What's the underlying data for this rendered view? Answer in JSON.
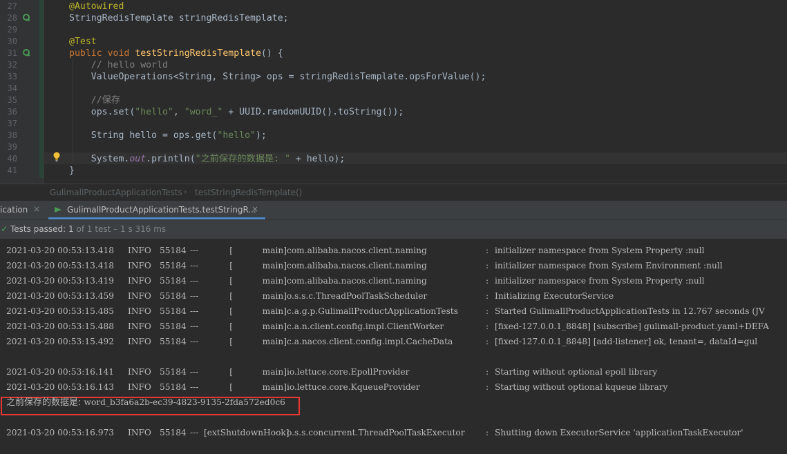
{
  "editor": {
    "lines": [
      {
        "num": "27",
        "tokens": [
          {
            "t": "@Autowired",
            "c": "ann"
          }
        ]
      },
      {
        "num": "28",
        "icon": "bean-gutter-icon",
        "tokens": [
          {
            "t": "StringRedisTemplate stringRedisTemplate;",
            "c": ""
          }
        ]
      },
      {
        "num": "29",
        "tokens": []
      },
      {
        "num": "30",
        "tokens": [
          {
            "t": "@Test",
            "c": "ann"
          }
        ]
      },
      {
        "num": "31",
        "icon": "run-test-gutter-icon",
        "tokens": [
          {
            "t": "public void ",
            "c": "kw"
          },
          {
            "t": "testStringRedisTemplate",
            "c": "mth"
          },
          {
            "t": "() {",
            "c": ""
          }
        ]
      },
      {
        "num": "32",
        "tokens": [
          {
            "t": "    // hello world",
            "c": "cm"
          }
        ]
      },
      {
        "num": "33",
        "tokens": [
          {
            "t": "    ValueOperations<String, String> ops = stringRedisTemplate.opsForValue();",
            "c": ""
          }
        ]
      },
      {
        "num": "34",
        "tokens": []
      },
      {
        "num": "35",
        "tokens": [
          {
            "t": "    //保存",
            "c": "cm"
          }
        ]
      },
      {
        "num": "36",
        "tokens": [
          {
            "t": "    ops.set(",
            "c": ""
          },
          {
            "t": "\"hello\"",
            "c": "str"
          },
          {
            "t": ", ",
            "c": ""
          },
          {
            "t": "\"word_\"",
            "c": "str"
          },
          {
            "t": " + UUID.randomUUID().toString());",
            "c": ""
          }
        ]
      },
      {
        "num": "37",
        "tokens": []
      },
      {
        "num": "38",
        "tokens": [
          {
            "t": "    String hello = ops.get(",
            "c": ""
          },
          {
            "t": "\"hello\"",
            "c": "str"
          },
          {
            "t": ");",
            "c": ""
          }
        ]
      },
      {
        "num": "39",
        "tokens": []
      },
      {
        "num": "40",
        "tokens": [
          {
            "t": "    System.",
            "c": ""
          },
          {
            "t": "out",
            "c": "fld"
          },
          {
            "t": ".println(",
            "c": ""
          },
          {
            "t": "\"之前保存的数据是: \"",
            "c": "str"
          },
          {
            "t": " + hello);",
            "c": ""
          }
        ]
      },
      {
        "num": "41",
        "tokens": [
          {
            "t": "}",
            "c": ""
          }
        ]
      }
    ]
  },
  "breadcrumb": {
    "class_name": "GulimallProductApplicationTests",
    "separator": "›",
    "method_name": "testStringRedisTemplate()"
  },
  "run_tabs": {
    "previous_label": "ication",
    "active_label": "GulimallProductApplicationTests.testStringR...",
    "close_glyph": "×"
  },
  "status": {
    "check_glyph": "✓",
    "label": "Tests passed: ",
    "count": "1",
    "detail": " of 1 test – 1 s 316 ms"
  },
  "console": {
    "lines": [
      {
        "ts": "2021-03-20 00:53:13.418",
        "level": "INFO",
        "pid": "55184",
        "dash": "---",
        "thread": "[           main]",
        "logger": "com.alibaba.nacos.client.naming",
        "msg": "initializer namespace from System Property :null"
      },
      {
        "ts": "2021-03-20 00:53:13.418",
        "level": "INFO",
        "pid": "55184",
        "dash": "---",
        "thread": "[           main]",
        "logger": "com.alibaba.nacos.client.naming",
        "msg": "initializer namespace from System Environment :null"
      },
      {
        "ts": "2021-03-20 00:53:13.419",
        "level": "INFO",
        "pid": "55184",
        "dash": "---",
        "thread": "[           main]",
        "logger": "com.alibaba.nacos.client.naming",
        "msg": "initializer namespace from System Property :null"
      },
      {
        "ts": "2021-03-20 00:53:13.459",
        "level": "INFO",
        "pid": "55184",
        "dash": "---",
        "thread": "[           main]",
        "logger": "o.s.s.c.ThreadPoolTaskScheduler",
        "msg": "Initializing ExecutorService"
      },
      {
        "ts": "2021-03-20 00:53:15.485",
        "level": "INFO",
        "pid": "55184",
        "dash": "---",
        "thread": "[           main]",
        "logger": "c.a.g.p.GulimallProductApplicationTests",
        "msg": "Started GulimallProductApplicationTests in 12.767 seconds (JV"
      },
      {
        "ts": "2021-03-20 00:53:15.488",
        "level": "INFO",
        "pid": "55184",
        "dash": "---",
        "thread": "[           main]",
        "logger": "c.a.n.client.config.impl.ClientWorker",
        "msg": "[fixed-127.0.0.1_8848] [subscribe] gulimall-product.yaml+DEFA"
      },
      {
        "ts": "2021-03-20 00:53:15.492",
        "level": "INFO",
        "pid": "55184",
        "dash": "---",
        "thread": "[           main]",
        "logger": "c.a.nacos.client.config.impl.CacheData",
        "msg": "[fixed-127.0.0.1_8848] [add-listener] ok, tenant=, dataId=gul"
      },
      null,
      {
        "ts": "2021-03-20 00:53:16.141",
        "level": "INFO",
        "pid": "55184",
        "dash": "---",
        "thread": "[           main]",
        "logger": "io.lettuce.core.EpollProvider",
        "msg": "Starting without optional epoll library"
      },
      {
        "ts": "2021-03-20 00:53:16.143",
        "level": "INFO",
        "pid": "55184",
        "dash": "---",
        "thread": "[           main]",
        "logger": "io.lettuce.core.KqueueProvider",
        "msg": "Starting without optional kqueue library"
      }
    ],
    "output_prefix": "之前保存的数据是: ",
    "output_value": "word_b3fa6a2b-ec39-4823-9135-2fda572ed0c6",
    "shutdown": {
      "ts": "2021-03-20 00:53:16.973",
      "level": "INFO",
      "pid": "55184",
      "dash": "---",
      "thread": "[extShutdownHook]",
      "logger": "o.s.s.concurrent.ThreadPoolTaskExecutor",
      "msg": "Shutting down ExecutorService 'applicationTaskExecutor'"
    },
    "colon": ":"
  },
  "colors": {
    "highlight_border": "#e53935",
    "tab_underline": "#4a88c7",
    "pass_check": "#499c54"
  }
}
